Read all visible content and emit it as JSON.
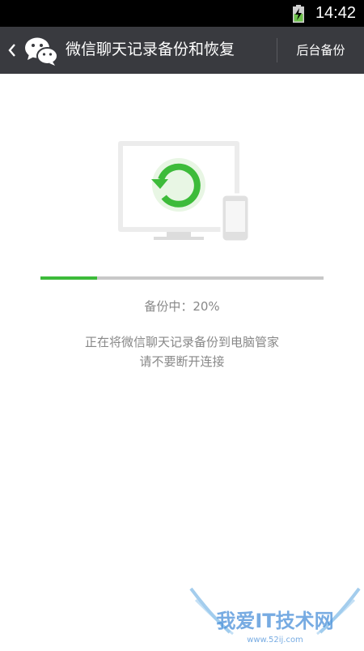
{
  "status_bar": {
    "time": "14:42",
    "battery_icon": "battery-charging-icon"
  },
  "header": {
    "back_icon": "chevron-left-icon",
    "logo_icon": "wechat-logo-icon",
    "title": "微信聊天记录备份和恢复",
    "action_label": "后台备份"
  },
  "illustration": {
    "icons": [
      "monitor-icon",
      "phone-icon",
      "sync-icon"
    ]
  },
  "progress": {
    "percent": 20,
    "label": "备份中：20%"
  },
  "message": {
    "line1": "正在将微信聊天记录备份到电脑管家",
    "line2": "请不要断开连接"
  },
  "watermark": {
    "text": "我爱IT技术网",
    "url": "www.52ij.com"
  },
  "colors": {
    "accent": "#3dbb3a",
    "header_bg": "#393a3f",
    "text_gray": "#888888",
    "track": "#c8c8c8"
  }
}
